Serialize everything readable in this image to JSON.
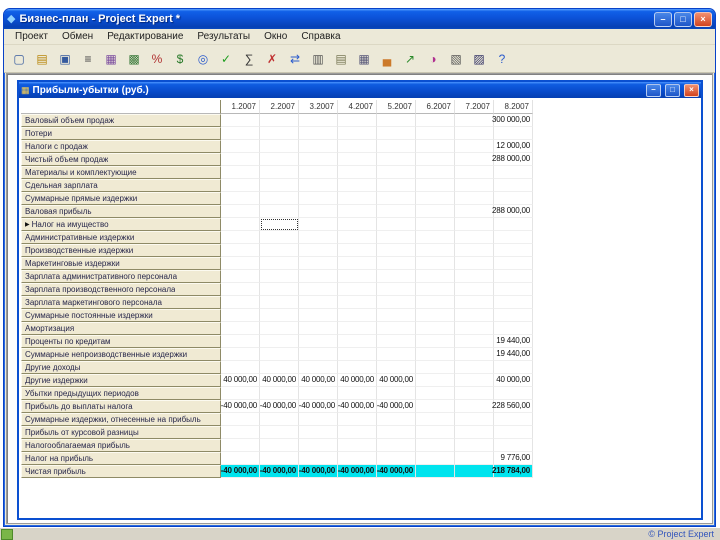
{
  "app": {
    "icon_glyph": "◆",
    "title": "Бизнес-план - Project Expert *",
    "controls": {
      "minimize": "–",
      "maximize": "□",
      "close": "×"
    },
    "menu": [
      "Проект",
      "Обмен",
      "Редактирование",
      "Результаты",
      "Окно",
      "Справка"
    ],
    "statusbar_text": "© Project Expert"
  },
  "toolbar": {
    "icons": [
      {
        "name": "new-project-icon",
        "glyph": "▢",
        "color": "#355a9e"
      },
      {
        "name": "open-project-icon",
        "glyph": "▤",
        "color": "#b8860b"
      },
      {
        "name": "save-project-icon",
        "glyph": "▣",
        "color": "#355a9e"
      },
      {
        "name": "text-description-icon",
        "glyph": "≡",
        "color": "#444444"
      },
      {
        "name": "calendar-icon",
        "glyph": "▦",
        "color": "#7a4a9e"
      },
      {
        "name": "calculator-icon",
        "glyph": "▩",
        "color": "#3a7a3a"
      },
      {
        "name": "percent-icon",
        "glyph": "%",
        "color": "#b03030"
      },
      {
        "name": "currency-icon",
        "glyph": "$",
        "color": "#2a7a2a"
      },
      {
        "name": "internet-icon",
        "glyph": "◎",
        "color": "#2a5acc"
      },
      {
        "name": "check-data-icon",
        "glyph": "✓",
        "color": "#1f9e1f"
      },
      {
        "name": "recalc-icon",
        "glyph": "∑",
        "color": "#333333"
      },
      {
        "name": "stop-icon",
        "glyph": "✗",
        "color": "#c03030"
      },
      {
        "name": "exchange-icon",
        "glyph": "⇄",
        "color": "#2a5acc"
      },
      {
        "name": "cashflow-table-icon",
        "glyph": "▥",
        "color": "#555555"
      },
      {
        "name": "profit-table-icon",
        "glyph": "▤",
        "color": "#777755"
      },
      {
        "name": "balance-table-icon",
        "glyph": "▦",
        "color": "#555577"
      },
      {
        "name": "bar-chart-icon",
        "glyph": "▄",
        "color": "#cc7a2a"
      },
      {
        "name": "line-graph-icon",
        "glyph": "↗",
        "color": "#2a8a2a"
      },
      {
        "name": "pie-chart-icon",
        "glyph": "◑",
        "color": "#b03090"
      },
      {
        "name": "report-icon",
        "glyph": "▧",
        "color": "#555555"
      },
      {
        "name": "print-report-icon",
        "glyph": "▨",
        "color": "#333366"
      },
      {
        "name": "help-icon",
        "glyph": "?",
        "color": "#2a5acc"
      }
    ]
  },
  "window": {
    "icon_glyph": "▦",
    "title": "Прибыли-убытки (руб.)",
    "controls": {
      "minimize": "–",
      "restore": "□",
      "close": "×"
    },
    "columns": [
      "1.2007",
      "2.2007",
      "3.2007",
      "4.2007",
      "5.2007",
      "6.2007",
      "7.2007",
      "8.2007"
    ],
    "selected_row": 8,
    "selected_col": 1,
    "selected_marker": "▶",
    "highlight_row": 27,
    "highlight_color": "#00e4ee",
    "rows": [
      {
        "label": "Валовый объем продаж",
        "values": [
          "",
          "",
          "",
          "",
          "",
          "",
          "",
          "300 000,00"
        ]
      },
      {
        "label": "Потери",
        "values": [
          "",
          "",
          "",
          "",
          "",
          "",
          "",
          ""
        ]
      },
      {
        "label": "Налоги с продаж",
        "values": [
          "",
          "",
          "",
          "",
          "",
          "",
          "",
          "12 000,00"
        ]
      },
      {
        "label": "Чистый объем продаж",
        "values": [
          "",
          "",
          "",
          "",
          "",
          "",
          "",
          "288 000,00"
        ]
      },
      {
        "label": "Материалы и комплектующие",
        "values": [
          "",
          "",
          "",
          "",
          "",
          "",
          "",
          ""
        ]
      },
      {
        "label": "Сдельная зарплата",
        "values": [
          "",
          "",
          "",
          "",
          "",
          "",
          "",
          ""
        ]
      },
      {
        "label": "Суммарные прямые издержки",
        "values": [
          "",
          "",
          "",
          "",
          "",
          "",
          "",
          ""
        ]
      },
      {
        "label": "Валовая прибыль",
        "values": [
          "",
          "",
          "",
          "",
          "",
          "",
          "",
          "288 000,00"
        ]
      },
      {
        "label": "Налог на имущество",
        "values": [
          "",
          "",
          "",
          "",
          "",
          "",
          "",
          ""
        ]
      },
      {
        "label": "Административные издержки",
        "values": [
          "",
          "",
          "",
          "",
          "",
          "",
          "",
          ""
        ]
      },
      {
        "label": "Производственные издержки",
        "values": [
          "",
          "",
          "",
          "",
          "",
          "",
          "",
          ""
        ]
      },
      {
        "label": "Маркетинговые издержки",
        "values": [
          "",
          "",
          "",
          "",
          "",
          "",
          "",
          ""
        ]
      },
      {
        "label": "Зарплата административного персонала",
        "values": [
          "",
          "",
          "",
          "",
          "",
          "",
          "",
          ""
        ]
      },
      {
        "label": "Зарплата производственного персонала",
        "values": [
          "",
          "",
          "",
          "",
          "",
          "",
          "",
          ""
        ]
      },
      {
        "label": "Зарплата маркетингового персонала",
        "values": [
          "",
          "",
          "",
          "",
          "",
          "",
          "",
          ""
        ]
      },
      {
        "label": "Суммарные постоянные издержки",
        "values": [
          "",
          "",
          "",
          "",
          "",
          "",
          "",
          ""
        ]
      },
      {
        "label": "Амортизация",
        "values": [
          "",
          "",
          "",
          "",
          "",
          "",
          "",
          ""
        ]
      },
      {
        "label": "Проценты по кредитам",
        "values": [
          "",
          "",
          "",
          "",
          "",
          "",
          "",
          "19 440,00"
        ]
      },
      {
        "label": "Суммарные непроизводственные издержки",
        "values": [
          "",
          "",
          "",
          "",
          "",
          "",
          "",
          "19 440,00"
        ]
      },
      {
        "label": "Другие доходы",
        "values": [
          "",
          "",
          "",
          "",
          "",
          "",
          "",
          ""
        ]
      },
      {
        "label": "Другие издержки",
        "values": [
          "40 000,00",
          "40 000,00",
          "40 000,00",
          "40 000,00",
          "40 000,00",
          "",
          "",
          "40 000,00"
        ]
      },
      {
        "label": "Убытки предыдущих периодов",
        "values": [
          "",
          "",
          "",
          "",
          "",
          "",
          "",
          ""
        ]
      },
      {
        "label": "Прибыль до выплаты налога",
        "values": [
          "-40 000,00",
          "-40 000,00",
          "-40 000,00",
          "-40 000,00",
          "-40 000,00",
          "",
          "",
          "228 560,00"
        ]
      },
      {
        "label": "Суммарные издержки, отнесенные на прибыль",
        "values": [
          "",
          "",
          "",
          "",
          "",
          "",
          "",
          ""
        ]
      },
      {
        "label": "Прибыль от курсовой разницы",
        "values": [
          "",
          "",
          "",
          "",
          "",
          "",
          "",
          ""
        ]
      },
      {
        "label": "Налогооблагаемая прибыль",
        "values": [
          "",
          "",
          "",
          "",
          "",
          "",
          "",
          ""
        ]
      },
      {
        "label": "Налог на прибыль",
        "values": [
          "",
          "",
          "",
          "",
          "",
          "",
          "",
          "9 776,00"
        ]
      },
      {
        "label": "Чистая прибыль",
        "values": [
          "-40 000,00",
          "-40 000,00",
          "-40 000,00",
          "-40 000,00",
          "-40 000,00",
          "",
          "",
          "218 784,00"
        ]
      }
    ]
  },
  "colors": {
    "titlebar": "#0b50d8",
    "label_bg": "#f0ead3",
    "highlight": "#00e4ee"
  }
}
